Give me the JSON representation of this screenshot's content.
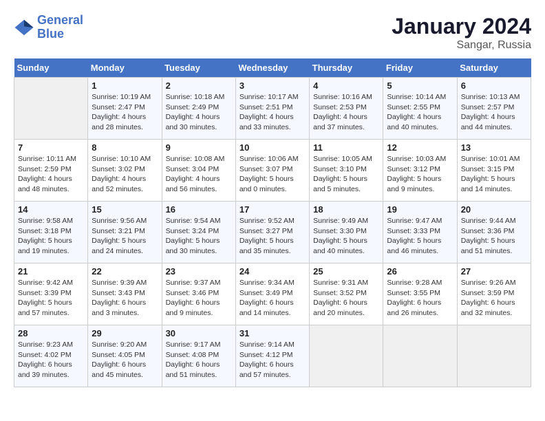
{
  "header": {
    "logo_line1": "General",
    "logo_line2": "Blue",
    "month": "January 2024",
    "location": "Sangar, Russia"
  },
  "weekdays": [
    "Sunday",
    "Monday",
    "Tuesday",
    "Wednesday",
    "Thursday",
    "Friday",
    "Saturday"
  ],
  "weeks": [
    [
      {
        "day": "",
        "sunrise": "",
        "sunset": "",
        "daylight": ""
      },
      {
        "day": "1",
        "sunrise": "Sunrise: 10:19 AM",
        "sunset": "Sunset: 2:47 PM",
        "daylight": "Daylight: 4 hours and 28 minutes."
      },
      {
        "day": "2",
        "sunrise": "Sunrise: 10:18 AM",
        "sunset": "Sunset: 2:49 PM",
        "daylight": "Daylight: 4 hours and 30 minutes."
      },
      {
        "day": "3",
        "sunrise": "Sunrise: 10:17 AM",
        "sunset": "Sunset: 2:51 PM",
        "daylight": "Daylight: 4 hours and 33 minutes."
      },
      {
        "day": "4",
        "sunrise": "Sunrise: 10:16 AM",
        "sunset": "Sunset: 2:53 PM",
        "daylight": "Daylight: 4 hours and 37 minutes."
      },
      {
        "day": "5",
        "sunrise": "Sunrise: 10:14 AM",
        "sunset": "Sunset: 2:55 PM",
        "daylight": "Daylight: 4 hours and 40 minutes."
      },
      {
        "day": "6",
        "sunrise": "Sunrise: 10:13 AM",
        "sunset": "Sunset: 2:57 PM",
        "daylight": "Daylight: 4 hours and 44 minutes."
      }
    ],
    [
      {
        "day": "7",
        "sunrise": "Sunrise: 10:11 AM",
        "sunset": "Sunset: 2:59 PM",
        "daylight": "Daylight: 4 hours and 48 minutes."
      },
      {
        "day": "8",
        "sunrise": "Sunrise: 10:10 AM",
        "sunset": "Sunset: 3:02 PM",
        "daylight": "Daylight: 4 hours and 52 minutes."
      },
      {
        "day": "9",
        "sunrise": "Sunrise: 10:08 AM",
        "sunset": "Sunset: 3:04 PM",
        "daylight": "Daylight: 4 hours and 56 minutes."
      },
      {
        "day": "10",
        "sunrise": "Sunrise: 10:06 AM",
        "sunset": "Sunset: 3:07 PM",
        "daylight": "Daylight: 5 hours and 0 minutes."
      },
      {
        "day": "11",
        "sunrise": "Sunrise: 10:05 AM",
        "sunset": "Sunset: 3:10 PM",
        "daylight": "Daylight: 5 hours and 5 minutes."
      },
      {
        "day": "12",
        "sunrise": "Sunrise: 10:03 AM",
        "sunset": "Sunset: 3:12 PM",
        "daylight": "Daylight: 5 hours and 9 minutes."
      },
      {
        "day": "13",
        "sunrise": "Sunrise: 10:01 AM",
        "sunset": "Sunset: 3:15 PM",
        "daylight": "Daylight: 5 hours and 14 minutes."
      }
    ],
    [
      {
        "day": "14",
        "sunrise": "Sunrise: 9:58 AM",
        "sunset": "Sunset: 3:18 PM",
        "daylight": "Daylight: 5 hours and 19 minutes."
      },
      {
        "day": "15",
        "sunrise": "Sunrise: 9:56 AM",
        "sunset": "Sunset: 3:21 PM",
        "daylight": "Daylight: 5 hours and 24 minutes."
      },
      {
        "day": "16",
        "sunrise": "Sunrise: 9:54 AM",
        "sunset": "Sunset: 3:24 PM",
        "daylight": "Daylight: 5 hours and 30 minutes."
      },
      {
        "day": "17",
        "sunrise": "Sunrise: 9:52 AM",
        "sunset": "Sunset: 3:27 PM",
        "daylight": "Daylight: 5 hours and 35 minutes."
      },
      {
        "day": "18",
        "sunrise": "Sunrise: 9:49 AM",
        "sunset": "Sunset: 3:30 PM",
        "daylight": "Daylight: 5 hours and 40 minutes."
      },
      {
        "day": "19",
        "sunrise": "Sunrise: 9:47 AM",
        "sunset": "Sunset: 3:33 PM",
        "daylight": "Daylight: 5 hours and 46 minutes."
      },
      {
        "day": "20",
        "sunrise": "Sunrise: 9:44 AM",
        "sunset": "Sunset: 3:36 PM",
        "daylight": "Daylight: 5 hours and 51 minutes."
      }
    ],
    [
      {
        "day": "21",
        "sunrise": "Sunrise: 9:42 AM",
        "sunset": "Sunset: 3:39 PM",
        "daylight": "Daylight: 5 hours and 57 minutes."
      },
      {
        "day": "22",
        "sunrise": "Sunrise: 9:39 AM",
        "sunset": "Sunset: 3:43 PM",
        "daylight": "Daylight: 6 hours and 3 minutes."
      },
      {
        "day": "23",
        "sunrise": "Sunrise: 9:37 AM",
        "sunset": "Sunset: 3:46 PM",
        "daylight": "Daylight: 6 hours and 9 minutes."
      },
      {
        "day": "24",
        "sunrise": "Sunrise: 9:34 AM",
        "sunset": "Sunset: 3:49 PM",
        "daylight": "Daylight: 6 hours and 14 minutes."
      },
      {
        "day": "25",
        "sunrise": "Sunrise: 9:31 AM",
        "sunset": "Sunset: 3:52 PM",
        "daylight": "Daylight: 6 hours and 20 minutes."
      },
      {
        "day": "26",
        "sunrise": "Sunrise: 9:28 AM",
        "sunset": "Sunset: 3:55 PM",
        "daylight": "Daylight: 6 hours and 26 minutes."
      },
      {
        "day": "27",
        "sunrise": "Sunrise: 9:26 AM",
        "sunset": "Sunset: 3:59 PM",
        "daylight": "Daylight: 6 hours and 32 minutes."
      }
    ],
    [
      {
        "day": "28",
        "sunrise": "Sunrise: 9:23 AM",
        "sunset": "Sunset: 4:02 PM",
        "daylight": "Daylight: 6 hours and 39 minutes."
      },
      {
        "day": "29",
        "sunrise": "Sunrise: 9:20 AM",
        "sunset": "Sunset: 4:05 PM",
        "daylight": "Daylight: 6 hours and 45 minutes."
      },
      {
        "day": "30",
        "sunrise": "Sunrise: 9:17 AM",
        "sunset": "Sunset: 4:08 PM",
        "daylight": "Daylight: 6 hours and 51 minutes."
      },
      {
        "day": "31",
        "sunrise": "Sunrise: 9:14 AM",
        "sunset": "Sunset: 4:12 PM",
        "daylight": "Daylight: 6 hours and 57 minutes."
      },
      {
        "day": "",
        "sunrise": "",
        "sunset": "",
        "daylight": ""
      },
      {
        "day": "",
        "sunrise": "",
        "sunset": "",
        "daylight": ""
      },
      {
        "day": "",
        "sunrise": "",
        "sunset": "",
        "daylight": ""
      }
    ]
  ]
}
